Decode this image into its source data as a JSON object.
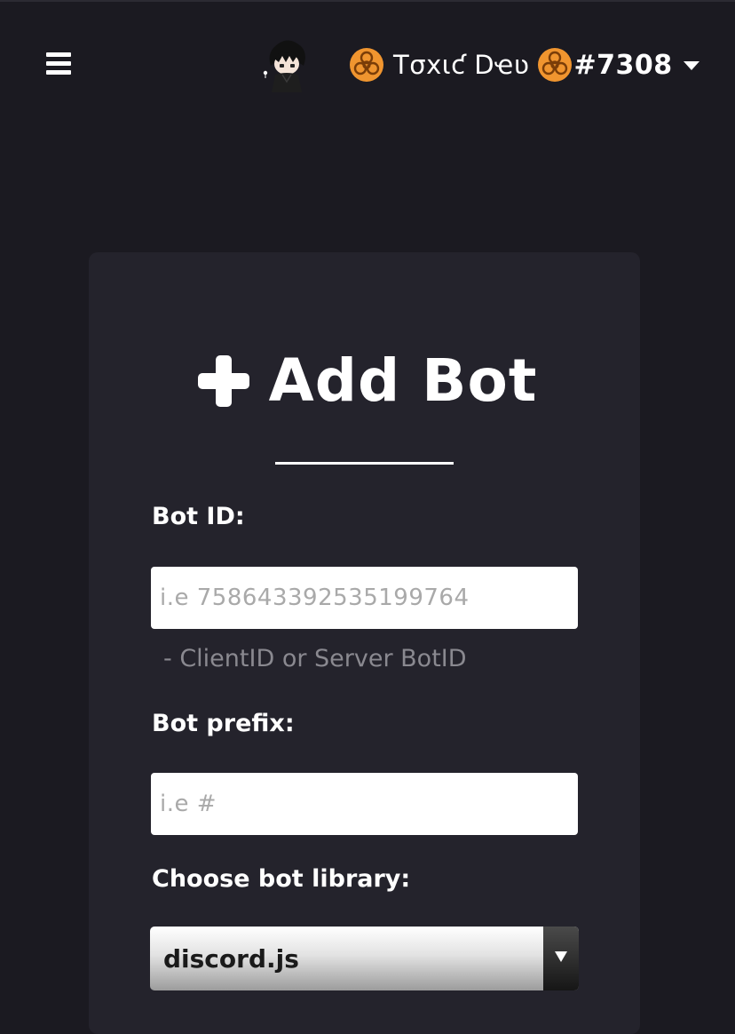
{
  "header": {
    "menu_icon": "hamburger-icon",
    "avatar_icon": "chibi-avatar",
    "user": {
      "left_emoji": "biohazard-icon",
      "name": "Tσxιƈ Dҽʋ",
      "right_emoji": "biohazard-icon",
      "discriminator": "#7308",
      "dropdown_icon": "caret-down-icon"
    }
  },
  "form": {
    "title": "Add Bot",
    "title_icon": "plus-icon",
    "bot_id": {
      "label": "Bot ID:",
      "placeholder": "i.e 758643392535199764",
      "hint": "- ClientID or Server BotID"
    },
    "bot_prefix": {
      "label": "Bot prefix:",
      "placeholder": "i.e #"
    },
    "library": {
      "label": "Choose bot library:",
      "selected": "discord.js"
    }
  },
  "colors": {
    "background": "#1b1a21",
    "card": "#24232c",
    "hazard_orange": "#f0952f",
    "hint_text": "#8a8990"
  }
}
